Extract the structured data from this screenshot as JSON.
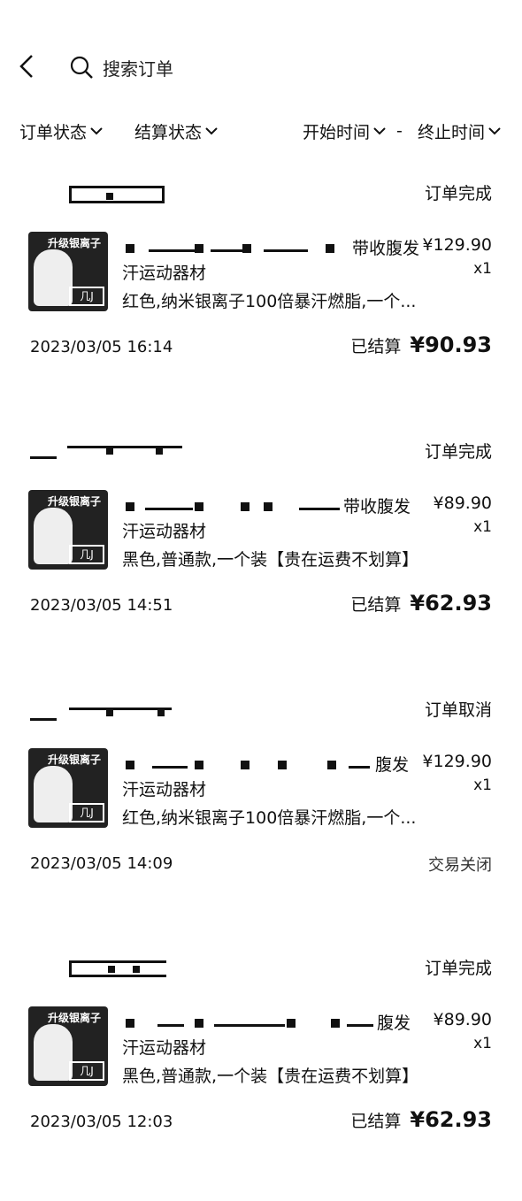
{
  "header": {
    "search_label": "搜索订单"
  },
  "filters": [
    {
      "label": "订单状态"
    },
    {
      "label": "结算状态"
    },
    {
      "label": "开始时间"
    },
    {
      "label": "终止时间"
    }
  ],
  "dash": "-",
  "orders": [
    {
      "status": "订单完成",
      "title_suffix": "带收腹发",
      "title_line2": "汗运动器材",
      "spec": "红色,纳米银离子100倍暴汗燃脂,一个...",
      "price": "¥129.90",
      "qty": "x1",
      "date": "2023/03/05 16:14",
      "settle_label": "已结算",
      "settle_amount": "¥90.93"
    },
    {
      "status": "订单完成",
      "title_suffix": "带收腹发",
      "title_line2": "汗运动器材",
      "spec": "黑色,普通款,一个装【贵在运费不划算】",
      "price": "¥89.90",
      "qty": "x1",
      "date": "2023/03/05 14:51",
      "settle_label": "已结算",
      "settle_amount": "¥62.93"
    },
    {
      "status": "订单取消",
      "title_suffix": "腹发",
      "title_line2": "汗运动器材",
      "spec": "红色,纳米银离子100倍暴汗燃脂,一个...",
      "price": "¥129.90",
      "qty": "x1",
      "date": "2023/03/05 14:09",
      "closed_text": "交易关闭"
    },
    {
      "status": "订单完成",
      "title_suffix": "腹发",
      "title_line2": "汗运动器材",
      "spec": "黑色,普通款,一个装【贵在运费不划算】",
      "price": "¥89.90",
      "qty": "x1",
      "date": "2023/03/05 12:03",
      "settle_label": "已结算",
      "settle_amount": "¥62.93"
    }
  ],
  "thumb_text": {
    "top": "升级银离子",
    "box": "几J"
  }
}
